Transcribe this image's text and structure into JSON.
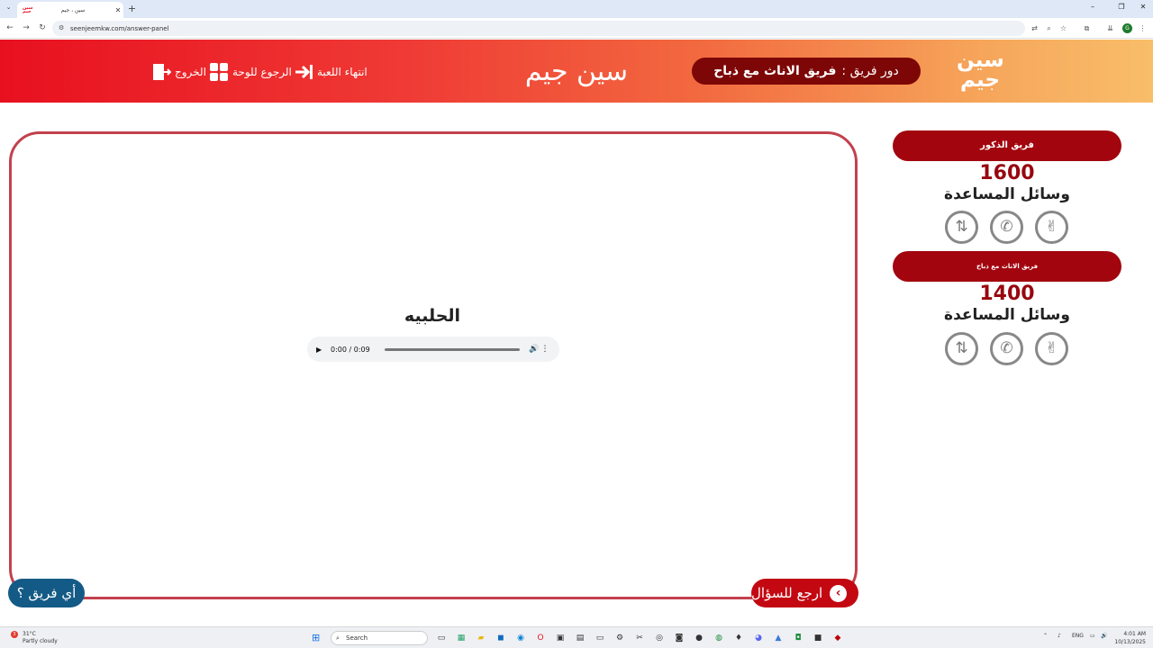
{
  "browser": {
    "tab_title": "سين ، جيم",
    "tab_favicon_text": "سين جيم",
    "url": "seenjeemkw.com/answer-panel"
  },
  "header": {
    "logo_text": "سين جيم",
    "turn_label": "دور فريق :",
    "turn_team": "فريق الاناث مع ذباح",
    "site_title": "سين جيم",
    "end_game_label": "انتهاء اللعبة",
    "back_to_board_label": "الرجوع للوحة",
    "exit_label": "الخروج"
  },
  "main": {
    "answer_text": "الحلبيه",
    "audio_time": "0:00 / 0:09",
    "back_button_label": "ارجع للسؤال",
    "which_team_button_label": "أي فريق ؟"
  },
  "teams": [
    {
      "name": "فريق الذكور",
      "score": "1600",
      "lifelines_label": "وسائل المساعدة",
      "lifelines": [
        "two-answers-icon",
        "phone-icon",
        "swap-icon"
      ]
    },
    {
      "name": "فريق الاناث مع ذباح",
      "score": "1400",
      "lifelines_label": "وسائل المساعدة",
      "lifelines": [
        "two-answers-icon",
        "phone-icon",
        "swap-icon"
      ]
    }
  ],
  "taskbar": {
    "temperature": "31°C",
    "weather": "Partly cloudy",
    "weather_badge": "3",
    "search_placeholder": "Search",
    "language": "ENG",
    "time": "4:01 AM",
    "date": "10/13/2025"
  },
  "colors": {
    "accent_dark_red": "#a2050e",
    "panel_border": "#c2414e",
    "which_team_blue": "#145a86"
  }
}
